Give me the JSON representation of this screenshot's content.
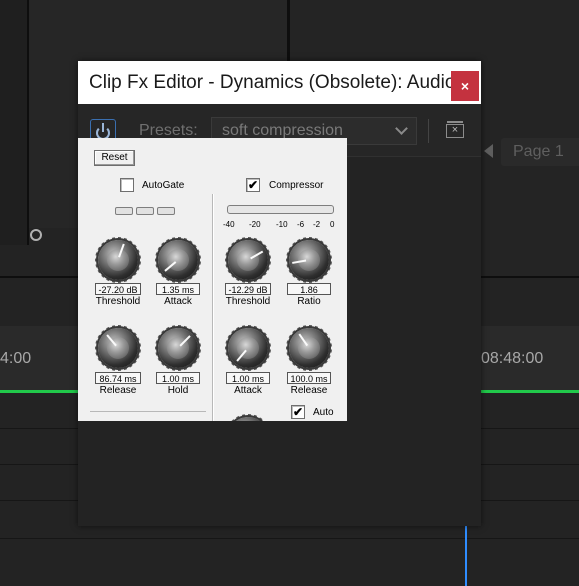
{
  "background": {
    "timecode_left": "4:00",
    "timecode_right": "08:48:00",
    "page_tab": "Page 1"
  },
  "dialog": {
    "title": "Clip Fx Editor - Dynamics (Obsolete): Audio ...",
    "close_glyph": "×",
    "presets_label": "Presets:",
    "preset_value": "soft compression",
    "delete_glyph": "×"
  },
  "plugin": {
    "reset_label": "Reset",
    "autogate": {
      "label": "AutoGate",
      "checked": false
    },
    "compressor": {
      "label": "Compressor",
      "checked": true
    },
    "meter_scale": [
      "-40",
      "-20",
      "-10",
      "-6",
      "-2",
      "0"
    ],
    "gate_knobs": [
      {
        "label": "Threshold",
        "value": "-27.20 dB"
      },
      {
        "label": "Attack",
        "value": "1.35 ms"
      },
      {
        "label": "Release",
        "value": "86.74 ms"
      },
      {
        "label": "Hold",
        "value": "1.00 ms"
      }
    ],
    "comp_knobs": [
      {
        "label": "Threshold",
        "value": "-12.29 dB"
      },
      {
        "label": "Ratio",
        "value": "1.86"
      },
      {
        "label": "Attack",
        "value": "1.00 ms"
      },
      {
        "label": "Release",
        "value": "100.0 ms"
      }
    ],
    "auto": {
      "label": "Auto",
      "checked": true
    },
    "check_glyph": "✔"
  },
  "colors": {
    "close": "#c4323f",
    "audio_line": "#21c94a",
    "playhead": "#2f8dff"
  }
}
